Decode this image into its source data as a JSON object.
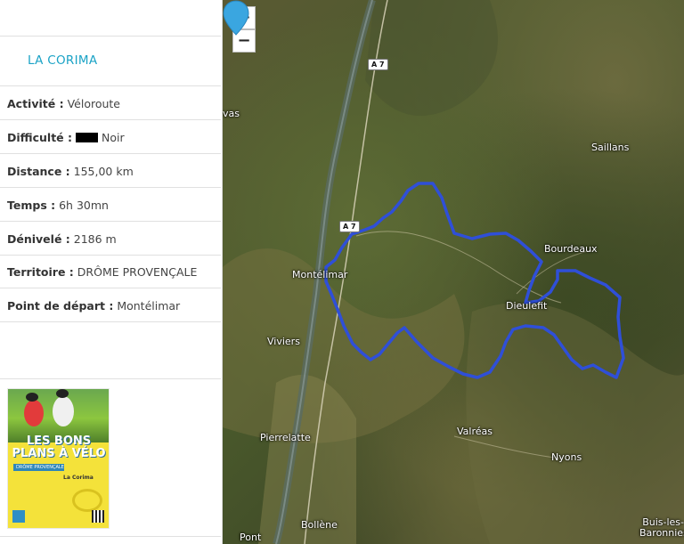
{
  "route": {
    "title": "LA CORIMA",
    "activity": {
      "label": "Activité :",
      "value": "Véloroute"
    },
    "difficulty": {
      "label": "Difficulté :",
      "value": "Noir",
      "color": "#000000"
    },
    "distance": {
      "label": "Distance :",
      "value": "155,00 km"
    },
    "time": {
      "label": "Temps :",
      "value": "6h 30mn"
    },
    "elevation": {
      "label": "Dénivelé :",
      "value": "2186 m"
    },
    "territory": {
      "label": "Territoire :",
      "value": "DRÔME PROVENÇALE"
    },
    "start": {
      "label": "Point de départ :",
      "value": "Montélimar"
    }
  },
  "brochure": {
    "headline": "LES BONS PLANS À VÉLO",
    "region": "DRÔME PROVENÇALE",
    "route_name": "La Corima"
  },
  "map": {
    "zoom_in": "+",
    "zoom_out": "−",
    "route_color": "#2f4fd8",
    "pin_color": "#3aa6e0",
    "places": {
      "montelimar": "Montélimar",
      "viviers": "Viviers",
      "pierrelatte": "Pierrelatte",
      "bollene": "Bollène",
      "valreas": "Valréas",
      "nyons": "Nyons",
      "dieulefit": "Dieulefit",
      "bourdeaux": "Bourdeaux",
      "saillans": "Saillans",
      "buis": "Buis-les-Baronnies",
      "vas": "vas",
      "pont": "Pont"
    },
    "roads": {
      "a7_north": "A 7",
      "a7_mid": "A 7"
    }
  }
}
